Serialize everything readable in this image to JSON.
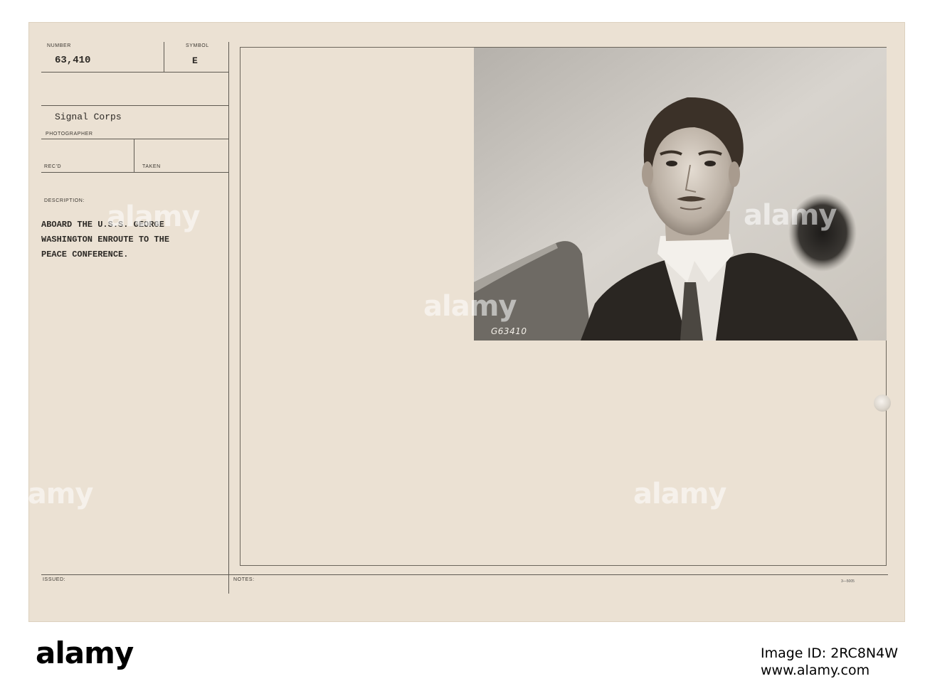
{
  "card": {
    "number_label": "NUMBER",
    "number_value": "63,410",
    "symbol_label": "SYMBOL",
    "symbol_value": "E",
    "photographer_value": "Signal Corps",
    "photographer_label": "PHOTOGRAPHER",
    "recd_label": "REC'D",
    "taken_label": "TAKEN",
    "description_label": "DESCRIPTION:",
    "description_lines": [
      "ABOARD THE U.S.S. GEORGE",
      "WASHINGTON ENROUTE TO THE",
      "PEACE CONFERENCE."
    ],
    "issued_label": "ISSUED:",
    "notes_label": "NOTES:",
    "form_code": "3—5005"
  },
  "photo": {
    "negative_code": "G63410",
    "alt": "portrait photograph of a man in suit and collar"
  },
  "footer": {
    "brand": "alamy",
    "image_id": "Image ID: 2RC8N4W",
    "website": "www.alamy.com"
  },
  "watermark": "alamy"
}
